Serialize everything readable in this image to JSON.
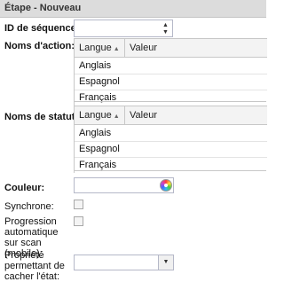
{
  "panel": {
    "title": "Étape - Nouveau"
  },
  "form": {
    "sequence_id_label": "ID de séquence:",
    "action_names_label": "Noms d'action:",
    "status_names_label": "Noms de statut:",
    "color_label": "Couleur:",
    "synchronous_label": "Synchrone:",
    "auto_progress_label": "Progression automatique sur scan (mobile):",
    "hide_state_property_label": "Propriété permettant de cacher l'état:"
  },
  "action_grid": {
    "columns": [
      "Langue",
      "Valeur"
    ],
    "rows": [
      "Anglais",
      "Espagnol",
      "Français"
    ]
  },
  "status_grid": {
    "columns": [
      "Langue",
      "Valeur"
    ],
    "rows": [
      "Anglais",
      "Espagnol",
      "Français"
    ]
  },
  "icons": {
    "sort": "sort-ascending-icon",
    "spin": "spinner-icon",
    "color": "color-picker-icon",
    "dropdown": "chevron-down-icon"
  }
}
